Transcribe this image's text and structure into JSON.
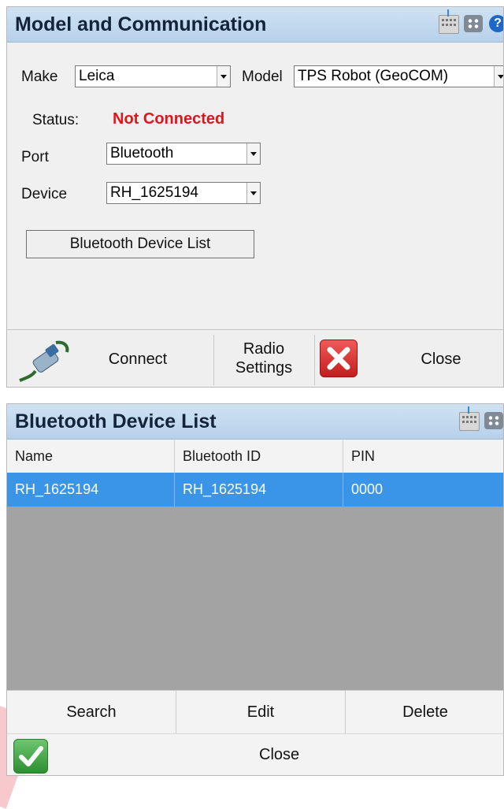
{
  "window1": {
    "title": "Model and Communication",
    "make_label": "Make",
    "make_value": "Leica",
    "model_label": "Model",
    "model_value": "TPS Robot (GeoCOM)",
    "status_label": "Status:",
    "status_value": "Not Connected",
    "status_color": "#e2141b",
    "port_label": "Port",
    "port_value": "Bluetooth",
    "device_label": "Device",
    "device_value": "RH_1625194",
    "bt_list_button": "Bluetooth Device List",
    "bottom": {
      "connect_label": "Connect",
      "radio_settings_line1": "Radio",
      "radio_settings_line2": "Settings",
      "close_label": "Close"
    },
    "icons": [
      "keyboard-icon",
      "grid-icon",
      "help-icon",
      "cable-icon",
      "close-x-icon"
    ]
  },
  "window2": {
    "title": "Bluetooth Device List",
    "columns": [
      "Name",
      "Bluetooth ID",
      "PIN"
    ],
    "rows": [
      [
        "RH_1625194",
        "RH_1625194",
        "0000"
      ]
    ],
    "selection_color": "#3a95e8",
    "actions": [
      "Search",
      "Edit",
      "Delete"
    ],
    "close_label": "Close",
    "icons": [
      "keyboard-icon",
      "grid-icon",
      "check-icon"
    ]
  }
}
